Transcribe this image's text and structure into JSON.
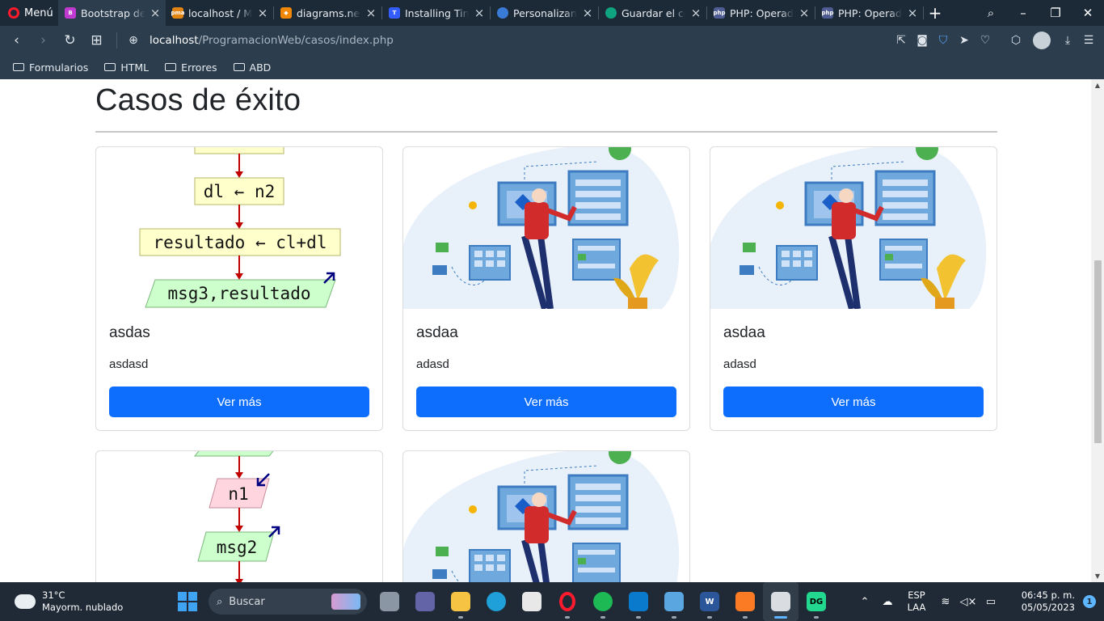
{
  "browser": {
    "menu_label": "Menú",
    "tabs": [
      {
        "label": "Bootstrap dem",
        "color": "#c13ad0",
        "active": true
      },
      {
        "label": "localhost / My",
        "color": "#e28412"
      },
      {
        "label": "diagrams.net",
        "color": "#f08705"
      },
      {
        "label": "Installing TinyM",
        "color": "#335dff"
      },
      {
        "label": "Personalizando",
        "color": "#3b7bd8"
      },
      {
        "label": "Guardar el cont",
        "color": "#10a37f"
      },
      {
        "label": "PHP: Operador",
        "color": "#4f5b93"
      },
      {
        "label": "PHP: Operador",
        "color": "#4f5b93"
      }
    ],
    "url_host": "localhost",
    "url_path": "/ProgramacionWeb/casos/index.php",
    "bookmarks": [
      "Formularios",
      "HTML",
      "Errores",
      "ABD"
    ]
  },
  "page": {
    "title": "Casos de éxito",
    "cards": [
      {
        "title": "asdas",
        "text": "asdasd",
        "button": "Ver más",
        "image": "flowchart-a"
      },
      {
        "title": "asdaa",
        "text": "adasd",
        "button": "Ver más",
        "image": "illustration"
      },
      {
        "title": "asdaa",
        "text": "adasd",
        "button": "Ver más",
        "image": "illustration"
      },
      {
        "title": "",
        "text": "",
        "button": "",
        "image": "flowchart-b"
      },
      {
        "title": "",
        "text": "",
        "button": "",
        "image": "illustration"
      }
    ],
    "flowchart_a": {
      "box1": "dl ← n2",
      "box2": "resultado ← cl+dl",
      "box3": "msg3,resultado"
    },
    "flowchart_b": {
      "box1": "n1",
      "box2": "msg2"
    }
  },
  "taskbar": {
    "weather_temp": "31°C",
    "weather_desc": "Mayorm. nublado",
    "search_placeholder": "Buscar",
    "lang_1": "ESP",
    "lang_2": "LAA",
    "time": "06:45 p. m.",
    "date": "05/05/2023",
    "notification_count": "1"
  }
}
